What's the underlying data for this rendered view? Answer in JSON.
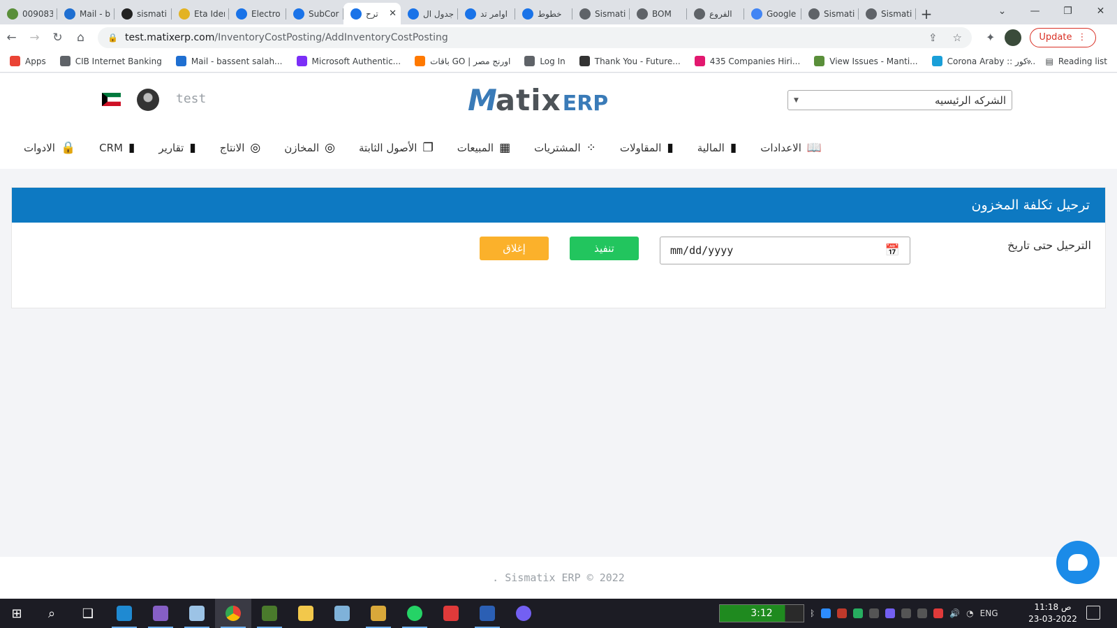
{
  "browser": {
    "tabs": [
      {
        "label": "009083",
        "color": "#5a8f3a"
      },
      {
        "label": "Mail - b",
        "color": "#1f6fd1"
      },
      {
        "label": "sismati",
        "color": "#222222"
      },
      {
        "label": "Eta Iden",
        "color": "#e3b323"
      },
      {
        "label": "Electro",
        "color": "#1a73e8"
      },
      {
        "label": "SubCor",
        "color": "#1a73e8"
      },
      {
        "label": "ترح",
        "color": "#1a73e8",
        "active": true
      },
      {
        "label": "جدول ال",
        "color": "#1a73e8"
      },
      {
        "label": "اوامر تد",
        "color": "#1a73e8"
      },
      {
        "label": "خطوط",
        "color": "#1a73e8"
      },
      {
        "label": "Sismati",
        "color": "#5f6368"
      },
      {
        "label": "BOM",
        "color": "#5f6368"
      },
      {
        "label": "الفروع",
        "color": "#5f6368"
      },
      {
        "label": "Google",
        "color": "#4285f4"
      },
      {
        "label": "Sismati",
        "color": "#5f6368"
      },
      {
        "label": "Sismati",
        "color": "#5f6368"
      }
    ],
    "url_host": "test.matixerp.com",
    "url_path": "/InventoryCostPosting/AddInventoryCostPosting",
    "update_label": "Update",
    "bookmarks": [
      {
        "label": "Apps",
        "color": "#ea4335"
      },
      {
        "label": "CIB Internet Banking",
        "color": "#5f6368"
      },
      {
        "label": "Mail - bassent salah...",
        "color": "#1f6fd1"
      },
      {
        "label": "Microsoft Authentic...",
        "color": "#7b2ff7"
      },
      {
        "label": "باقات GO | اورنج مصر",
        "color": "#ff7900"
      },
      {
        "label": "Log In",
        "color": "#5f6368"
      },
      {
        "label": "Thank You - Future...",
        "color": "#333333"
      },
      {
        "label": "435 Companies Hiri...",
        "color": "#e2186f"
      },
      {
        "label": "View Issues - Manti...",
        "color": "#5a8f3a"
      },
      {
        "label": "Corona Araby :: كور...",
        "color": "#1a9fd8"
      }
    ],
    "more_label": "»",
    "reading_list_label": "Reading list"
  },
  "header": {
    "username": "test",
    "logo_m": "M",
    "logo_rest": "atix",
    "logo_erp": "ERP",
    "company_select_value": "الشركه الرئيسيه"
  },
  "nav": {
    "items": [
      {
        "label": "الاعدادات",
        "icon": "book-icon",
        "glyph": "📖"
      },
      {
        "label": "المالية",
        "icon": "file-icon",
        "glyph": "▮"
      },
      {
        "label": "المقاولات",
        "icon": "file-check-icon",
        "glyph": "▮"
      },
      {
        "label": "المشتريات",
        "icon": "dots-icon",
        "glyph": "⁘"
      },
      {
        "label": "المبيعات",
        "icon": "grid-icon",
        "glyph": "▦"
      },
      {
        "label": "الأصول الثابتة",
        "icon": "copy-icon",
        "glyph": "❐"
      },
      {
        "label": "المخازن",
        "icon": "target-icon",
        "glyph": "◎"
      },
      {
        "label": "الانتاج",
        "icon": "target-icon",
        "glyph": "◎"
      },
      {
        "label": "تقارير",
        "icon": "file-icon",
        "glyph": "▮"
      },
      {
        "label": "CRM",
        "icon": "file-icon",
        "glyph": "▮"
      },
      {
        "label": "الادوات",
        "icon": "lock-icon",
        "glyph": "🔒"
      }
    ]
  },
  "panel": {
    "title": "ترحيل تكلفة المخزون",
    "field_label": "الترحيل حتى تاريخ",
    "date_placeholder": "mm/dd/yyyy",
    "execute_label": "تنفيذ",
    "close_label": "إغلاق"
  },
  "footer": {
    "text": ". Sismatix ERP © 2022"
  },
  "taskbar": {
    "timer": "3:12",
    "language": "ENG",
    "time": "11:18 ص",
    "date": "23-03-2022"
  },
  "colors": {
    "panel_header": "#0d79c2",
    "execute": "#22c55e",
    "close": "#fbb12b",
    "logo_blue": "#3a7bb8"
  }
}
